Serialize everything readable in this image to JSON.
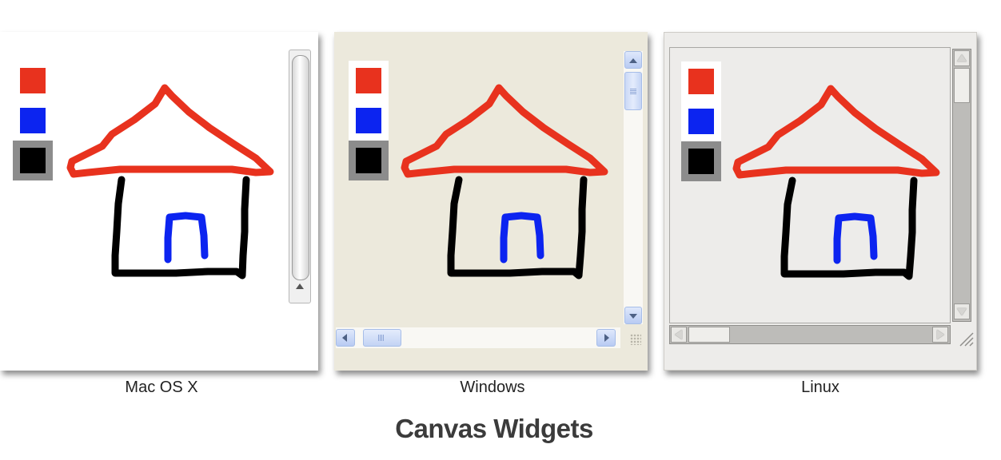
{
  "figure_title": "Canvas Widgets",
  "panels": [
    {
      "caption": "Mac OS X"
    },
    {
      "caption": "Windows"
    },
    {
      "caption": "Linux"
    }
  ],
  "palette": [
    {
      "name": "red",
      "color": "#e8321e"
    },
    {
      "name": "blue",
      "color": "#0c24f0"
    },
    {
      "name": "black",
      "color": "#000000",
      "selected": true
    }
  ],
  "colors": {
    "mac_bg": "#ffffff",
    "windows_bg": "#ece9dc",
    "linux_bg": "#edecea",
    "stroke_red": "#e8321e",
    "stroke_blue": "#0c24f0",
    "stroke_black": "#000000"
  }
}
